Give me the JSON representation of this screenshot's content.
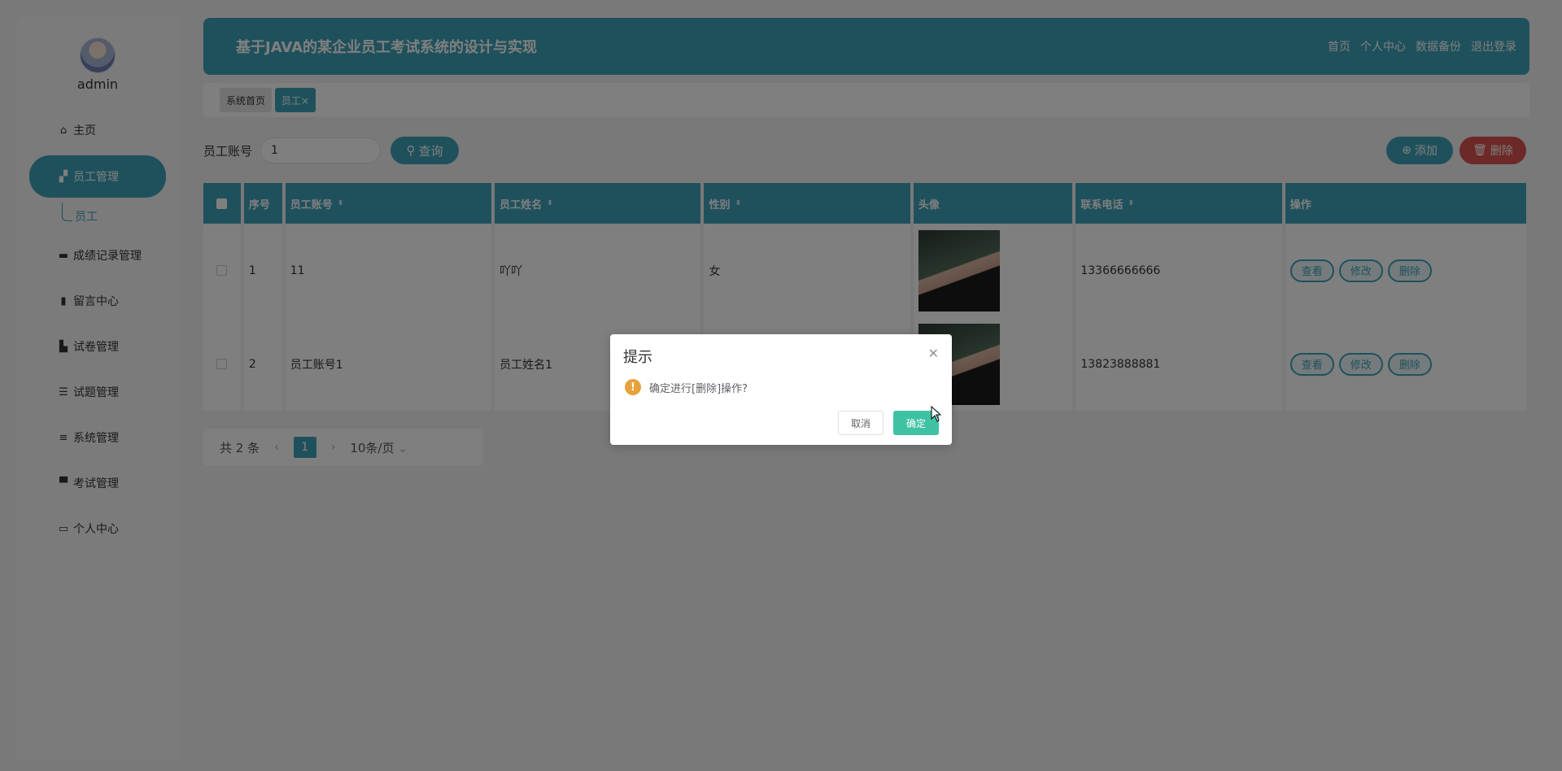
{
  "sidebar": {
    "username": "admin",
    "items": [
      {
        "label": "主页",
        "icon": "home-icon"
      },
      {
        "label": "员工管理",
        "icon": "thumb-icon",
        "active": true
      },
      {
        "label": "成绩记录管理",
        "icon": "monitor-icon"
      },
      {
        "label": "留言中心",
        "icon": "bar-chart-icon"
      },
      {
        "label": "试卷管理",
        "icon": "book-icon"
      },
      {
        "label": "试题管理",
        "icon": "list-icon"
      },
      {
        "label": "系统管理",
        "icon": "menu-icon"
      },
      {
        "label": "考试管理",
        "icon": "briefcase-icon"
      },
      {
        "label": "个人中心",
        "icon": "card-icon"
      }
    ],
    "submenu": {
      "label": "员工"
    }
  },
  "header": {
    "title": "基于JAVA的某企业员工考试系统的设计与实现",
    "links": [
      "首页",
      "个人中心",
      "数据备份",
      "退出登录"
    ]
  },
  "tabs": {
    "home": "系统首页",
    "active": "员工×"
  },
  "search": {
    "label": "员工账号",
    "value": "1",
    "button": "查询"
  },
  "actions": {
    "add": "添加",
    "delete": "删除"
  },
  "table": {
    "headers": [
      "序号",
      "员工账号",
      "员工姓名",
      "性别",
      "头像",
      "联系电话",
      "操作"
    ],
    "rows": [
      {
        "idx": "1",
        "account": "11",
        "name": "吖吖",
        "sex": "女",
        "phone": "13366666666"
      },
      {
        "idx": "2",
        "account": "员工账号1",
        "name": "员工姓名1",
        "sex": "",
        "phone": "13823888881"
      }
    ],
    "ops": [
      "查看",
      "修改",
      "删除"
    ]
  },
  "pager": {
    "total": "共 2 条",
    "page": "1",
    "size": "10条/页"
  },
  "modal": {
    "title": "提示",
    "message": "确定进行[删除]操作?",
    "cancel": "取消",
    "ok": "确定"
  }
}
